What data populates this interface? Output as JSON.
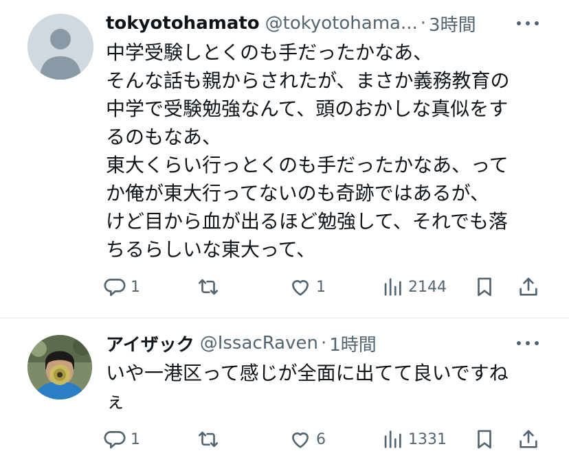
{
  "tweets": [
    {
      "name": "tokyotohamato",
      "handle": "@tokyotohama...",
      "separator": "·",
      "time": "3時間",
      "lines": [
        "中学受験しとくのも手だったかなあ、",
        "そんな話も親からされたが、まさか義務教育の",
        "中学で受験勉強なんて、頭のおかしな真似をす",
        "るのもなあ、",
        "東大くらい行っとくのも手だったかなあ、って",
        "か俺が東大行ってないのも奇跡ではあるが、",
        "けど目から血が出るほど勉強して、それでも落",
        "ちるらしいな東大って、"
      ],
      "replies": "1",
      "retweets": "",
      "likes": "1",
      "views": "2144"
    },
    {
      "name": "アイザック",
      "handle": "@IssacRaven",
      "separator": "·",
      "time": "1時間",
      "lines": [
        "いや一港区って感じが全面に出てて良いですね",
        "ぇ"
      ],
      "replies": "1",
      "retweets": "",
      "likes": "6",
      "views": "1331"
    }
  ],
  "colors": {
    "text": "#0f1419",
    "secondary": "#536471",
    "divider": "#eff3f4",
    "default_avatar": "#cfd9de"
  }
}
